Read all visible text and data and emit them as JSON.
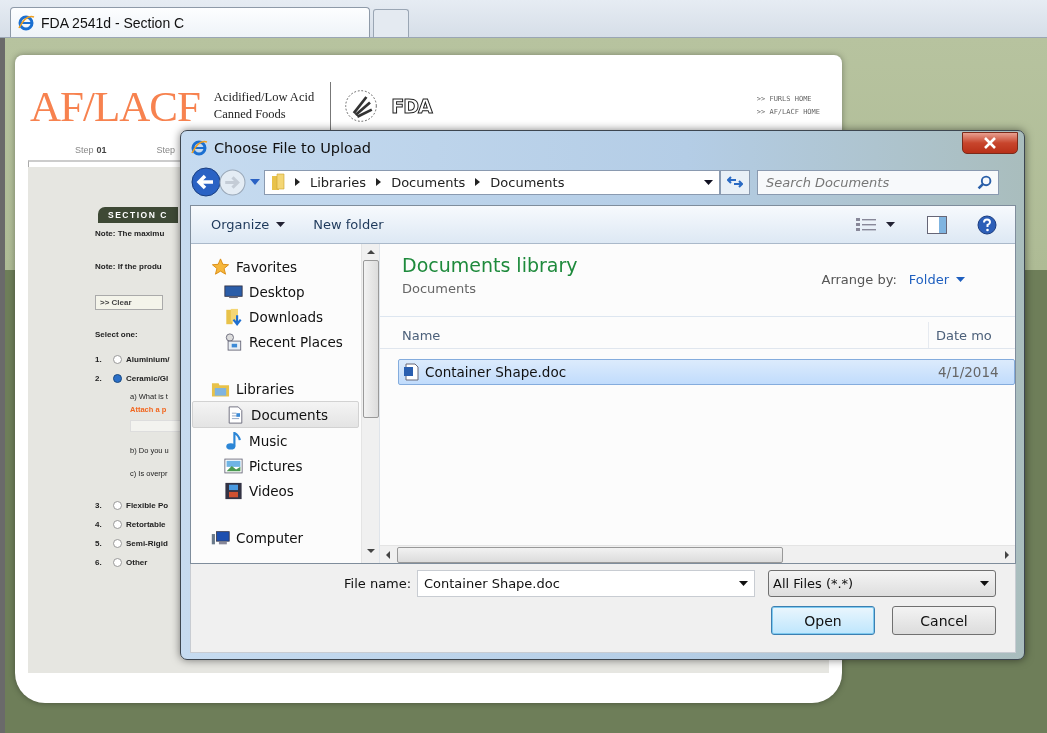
{
  "browser": {
    "tabs": [
      {
        "title": "FDA 2541d - Section C",
        "selected": true
      }
    ]
  },
  "page": {
    "header": {
      "logo_text": "AF/LACF",
      "tagline": [
        "Acidified/Low Acid",
        "Canned Foods"
      ],
      "agency": "FDA",
      "links": [
        ">> FURLS HOME",
        ">> AF/LACF HOME"
      ]
    },
    "steps": [
      {
        "label": "Step",
        "number": "01"
      },
      {
        "label": "Step"
      }
    ],
    "section_tab": "SECTION C",
    "notes": [
      "Note: The maximu",
      "Note: If the produ"
    ],
    "clear_button": ">> Clear",
    "prompt": "Select one:",
    "options": [
      {
        "number": "1.",
        "label": "Aluminium/",
        "selected": false
      },
      {
        "number": "2.",
        "label": "Ceramic/Gl",
        "selected": true,
        "sub": [
          {
            "kind": "question",
            "text": "a) What is t"
          },
          {
            "kind": "link",
            "text": "Attach a p"
          },
          {
            "kind": "field"
          },
          {
            "kind": "question",
            "text": "b) Do you u"
          },
          {
            "kind": "question",
            "text": "c) Is overpr"
          }
        ]
      },
      {
        "number": "3.",
        "label": "Flexible Po",
        "selected": false
      },
      {
        "number": "4.",
        "label": "Retortable",
        "selected": false
      },
      {
        "number": "5.",
        "label": "Semi-Rigid",
        "selected": false
      },
      {
        "number": "6.",
        "label": "Other",
        "selected": false
      }
    ]
  },
  "dialog": {
    "title": "Choose File to Upload",
    "address": [
      "Libraries",
      "Documents",
      "Documents"
    ],
    "search": {
      "placeholder": "Search Documents"
    },
    "toolbar": [
      {
        "label": "Organize",
        "kind": "menu"
      },
      {
        "label": "New folder",
        "kind": "button"
      }
    ],
    "nav": [
      {
        "label": "Favorites",
        "kind": "star",
        "selected": false,
        "children": [
          {
            "label": "Desktop",
            "kind": "desktop",
            "selected": false
          },
          {
            "label": "Downloads",
            "kind": "downloads",
            "selected": false
          },
          {
            "label": "Recent Places",
            "kind": "recent",
            "selected": false
          }
        ]
      },
      {
        "label": "Libraries",
        "kind": "libraries",
        "selected": false,
        "children": [
          {
            "label": "Documents",
            "kind": "documents",
            "selected": true
          },
          {
            "label": "Music",
            "kind": "music",
            "selected": false
          },
          {
            "label": "Pictures",
            "kind": "pictures",
            "selected": false
          },
          {
            "label": "Videos",
            "kind": "videos",
            "selected": false
          }
        ]
      },
      {
        "label": "Computer",
        "kind": "computer",
        "selected": false
      }
    ],
    "library": {
      "title": "Documents library",
      "subtitle": "Documents",
      "arrange_label": "Arrange by:",
      "arrange_value": "Folder"
    },
    "columns": [
      "Name",
      "Date mo"
    ],
    "rows": [
      {
        "name": "Container Shape.doc",
        "date": "4/1/2014",
        "selected": true
      }
    ],
    "file_name": {
      "label": "File name:",
      "value": "Container Shape.doc"
    },
    "filter": "All Files (*.*)",
    "buttons": [
      {
        "label": "Open",
        "default": true
      },
      {
        "label": "Cancel",
        "default": false
      }
    ]
  }
}
